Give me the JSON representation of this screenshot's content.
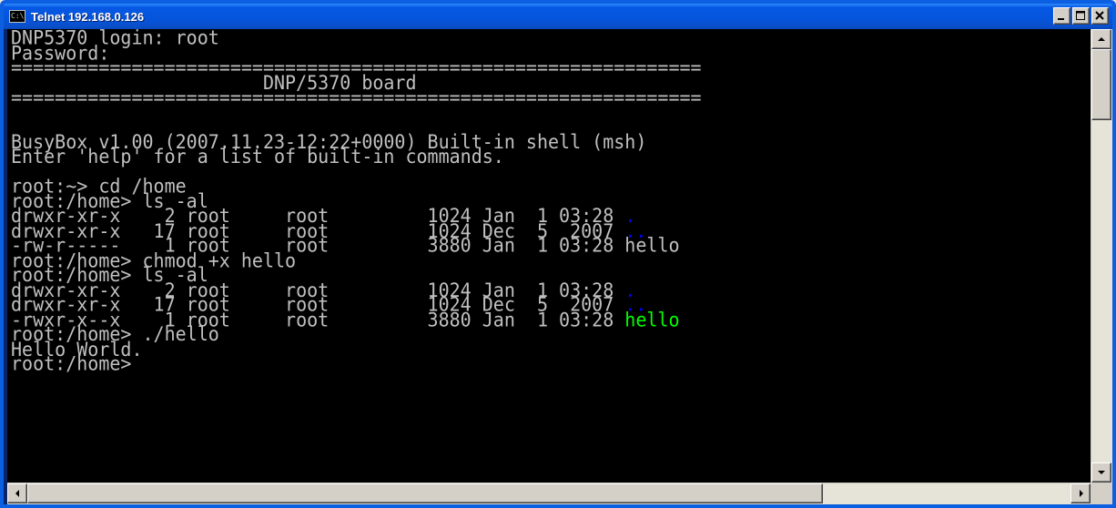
{
  "window": {
    "title": "Telnet 192.168.0.126",
    "icon": "console-icon",
    "icon_text": "C:\\"
  },
  "terminal": {
    "lines": [
      {
        "segments": [
          {
            "text": "DNP5370 login: root"
          }
        ]
      },
      {
        "segments": [
          {
            "text": "Password:"
          }
        ]
      },
      {
        "segments": [
          {
            "text": "==============================================================="
          }
        ]
      },
      {
        "segments": [
          {
            "text": "                       DNP/5370 board"
          }
        ]
      },
      {
        "segments": [
          {
            "text": "==============================================================="
          }
        ]
      },
      {
        "segments": [
          {
            "text": ""
          }
        ]
      },
      {
        "segments": [
          {
            "text": ""
          }
        ]
      },
      {
        "segments": [
          {
            "text": "BusyBox v1.00 (2007.11.23-12:22+0000) Built-in shell (msh)"
          }
        ]
      },
      {
        "segments": [
          {
            "text": "Enter 'help' for a list of built-in commands."
          }
        ]
      },
      {
        "segments": [
          {
            "text": ""
          }
        ]
      },
      {
        "segments": [
          {
            "text": "root:~> cd /home"
          }
        ]
      },
      {
        "segments": [
          {
            "text": "root:/home> ls -al"
          }
        ]
      },
      {
        "segments": [
          {
            "text": "drwxr-xr-x    2 root     root         1024 Jan  1 03:28 "
          },
          {
            "text": ".",
            "color": "blue"
          }
        ]
      },
      {
        "segments": [
          {
            "text": "drwxr-xr-x   17 root     root         1024 Dec  5  2007 "
          },
          {
            "text": "..",
            "color": "blue"
          }
        ]
      },
      {
        "segments": [
          {
            "text": "-rw-r-----    1 root     root         3880 Jan  1 03:28 hello"
          }
        ]
      },
      {
        "segments": [
          {
            "text": "root:/home> chmod +x hello"
          }
        ]
      },
      {
        "segments": [
          {
            "text": "root:/home> ls -al"
          }
        ]
      },
      {
        "segments": [
          {
            "text": "drwxr-xr-x    2 root     root         1024 Jan  1 03:28 "
          },
          {
            "text": ".",
            "color": "blue"
          }
        ]
      },
      {
        "segments": [
          {
            "text": "drwxr-xr-x   17 root     root         1024 Dec  5  2007 "
          },
          {
            "text": "..",
            "color": "blue"
          }
        ]
      },
      {
        "segments": [
          {
            "text": "-rwxr-x--x    1 root     root         3880 Jan  1 03:28 "
          },
          {
            "text": "hello",
            "color": "green"
          }
        ]
      },
      {
        "segments": [
          {
            "text": "root:/home> ./hello"
          }
        ]
      },
      {
        "segments": [
          {
            "text": "Hello World."
          }
        ]
      },
      {
        "segments": [
          {
            "text": "root:/home>"
          }
        ]
      }
    ]
  },
  "colors": {
    "terminal_bg": "#000000",
    "terminal_fg": "#c0c0c0",
    "dir_color": "#0000ff",
    "exec_color": "#00ff00",
    "titlebar": "#0554dc"
  },
  "scrollbars": {
    "vertical": {
      "up_icon": "arrow-up-icon",
      "down_icon": "arrow-down-icon"
    },
    "horizontal": {
      "left_icon": "arrow-left-icon",
      "right_icon": "arrow-right-icon"
    }
  }
}
